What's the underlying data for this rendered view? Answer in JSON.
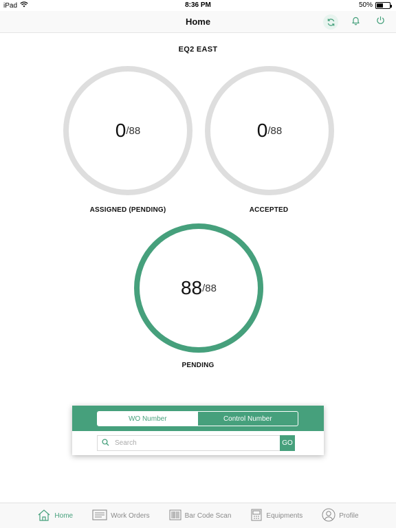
{
  "status_bar": {
    "device": "iPad",
    "time": "8:36 PM",
    "battery": "50%"
  },
  "nav": {
    "title": "Home"
  },
  "section": {
    "title": "EQ2 EAST"
  },
  "gauges": [
    {
      "count": "0",
      "total": "/88",
      "label": "ASSIGNED (PENDING)"
    },
    {
      "count": "0",
      "total": "/88",
      "label": "ACCEPTED"
    },
    {
      "count": "88",
      "total": "/88",
      "label": "PENDING"
    }
  ],
  "search": {
    "tabs": [
      "WO Number",
      "Control Number"
    ],
    "placeholder": "Search",
    "go_label": "GO"
  },
  "tab_bar": {
    "items": [
      {
        "label": "Home",
        "icon": "home-icon",
        "active": true
      },
      {
        "label": "Work Orders",
        "icon": "work-orders-icon"
      },
      {
        "label": "Bar Code Scan",
        "icon": "barcode-icon"
      },
      {
        "label": "Equipments",
        "icon": "equipments-icon"
      },
      {
        "label": "Profile",
        "icon": "profile-icon"
      }
    ]
  },
  "colors": {
    "accent": "#46a07c",
    "gauge_empty": "#dedede"
  }
}
